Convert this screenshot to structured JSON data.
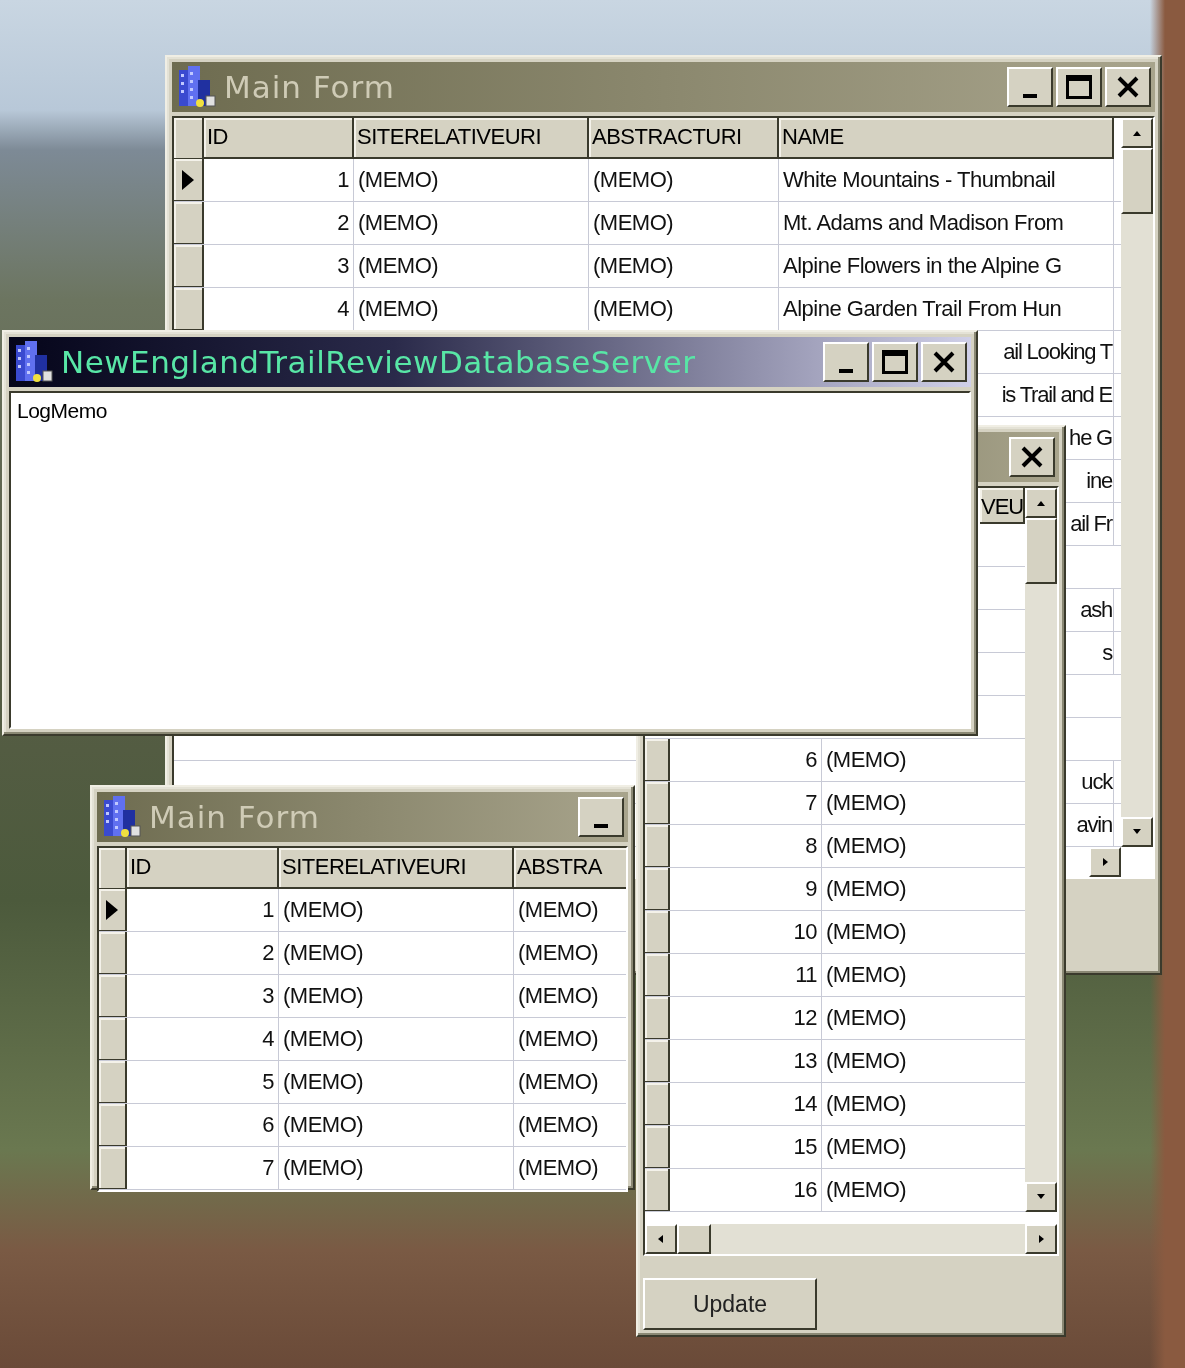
{
  "back_form": {
    "title": "Main Form",
    "columns": [
      "ID",
      "SITERELATIVEURI",
      "ABSTRACTURI",
      "NAME"
    ],
    "rows": [
      {
        "id": "1",
        "site": "(MEMO)",
        "abstract": "(MEMO)",
        "name": "White Mountains - Thumbnail",
        "current": true
      },
      {
        "id": "2",
        "site": "(MEMO)",
        "abstract": "(MEMO)",
        "name": "Mt. Adams and Madison From",
        "current": false
      },
      {
        "id": "3",
        "site": "(MEMO)",
        "abstract": "(MEMO)",
        "name": "Alpine Flowers in the Alpine G",
        "current": false
      },
      {
        "id": "4",
        "site": "(MEMO)",
        "abstract": "(MEMO)",
        "name": "Alpine Garden Trail From Hun",
        "current": false
      },
      {
        "name_tail": "ail Looking T"
      },
      {
        "name_tail": "is Trail and E"
      },
      {
        "name_tail": "he G"
      },
      {
        "name_tail": "ine"
      },
      {
        "name_tail": "ail Fr"
      },
      {},
      {
        "name_tail": "ash"
      },
      {
        "name_tail": "s"
      },
      {},
      {},
      {
        "name_tail": "uck"
      },
      {
        "name_tail": "avin"
      }
    ]
  },
  "small_form": {
    "title": "Main Form",
    "columns": [
      "ID",
      "SITERELATIVEURI",
      "ABSTRA"
    ],
    "rows": [
      {
        "id": "1",
        "site": "(MEMO)",
        "abstract": "(MEMO)",
        "current": true
      },
      {
        "id": "2",
        "site": "(MEMO)",
        "abstract": "(MEMO)",
        "current": false
      },
      {
        "id": "3",
        "site": "(MEMO)",
        "abstract": "(MEMO)",
        "current": false
      },
      {
        "id": "4",
        "site": "(MEMO)",
        "abstract": "(MEMO)",
        "current": false
      },
      {
        "id": "5",
        "site": "(MEMO)",
        "abstract": "(MEMO)",
        "current": false
      },
      {
        "id": "6",
        "site": "(MEMO)",
        "abstract": "(MEMO)",
        "current": false
      },
      {
        "id": "7",
        "site": "(MEMO)",
        "abstract": "(MEMO)",
        "current": false
      }
    ]
  },
  "editor_form": {
    "header_tail": "VEU",
    "rows": [
      {},
      {},
      {},
      {},
      {},
      {
        "id": "6",
        "site": "(MEMO)",
        "current": false
      },
      {
        "id": "7",
        "site": "(MEMO)",
        "current": false
      },
      {
        "id": "8",
        "site": "(MEMO)",
        "current": false
      },
      {
        "id": "9",
        "site": "(MEMO)",
        "current": false
      },
      {
        "id": "10",
        "site": "(MEMO)",
        "current": false
      },
      {
        "id": "11",
        "site": "(MEMO)",
        "current": false
      },
      {
        "id": "12",
        "site": "(MEMO)",
        "current": false
      },
      {
        "id": "13",
        "site": "(MEMO)",
        "current": false
      },
      {
        "id": "14",
        "site": "(MEMO)",
        "current": false
      },
      {
        "id": "15",
        "site": "(MEMO)",
        "current": false
      },
      {
        "id": "16",
        "site": "(MEMO)",
        "current": false
      }
    ],
    "button": "Update"
  },
  "server_window": {
    "title": "NewEnglandTrailReviewDatabaseServer",
    "memo": "LogMemo"
  }
}
